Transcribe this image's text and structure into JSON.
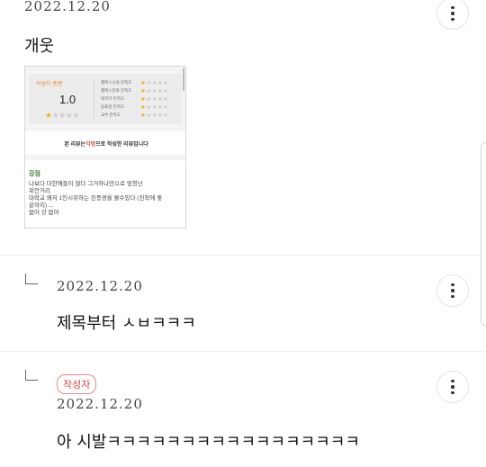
{
  "comments": [
    {
      "date": "2022.12.20",
      "text": "개웃",
      "more_icon": "more-vertical-icon",
      "attachment": {
        "summary_label": "작성자 총평",
        "overall_score": "1.0",
        "overall_stars": 1,
        "ratings": [
          {
            "label": "캠퍼스시설 만족도",
            "stars": 1
          },
          {
            "label": "캠퍼스문화 만족도",
            "stars": 1
          },
          {
            "label": "대학가 만족도",
            "stars": 1
          },
          {
            "label": "동료감 만족도",
            "stars": 1
          },
          {
            "label": "교수 만족도",
            "stars": 1
          }
        ],
        "notice_pre": "본 리뷰는 ",
        "notice_highlight": "익명",
        "notice_post": "으로 작성한 리뷰입니다",
        "review_title": "강점",
        "review_lines": [
          "나보다 더한애들이 많다 그거하나만으로 엄청난",
          "위안거리",
          "대학교 왜저 1인시위하는 진풍경을 볼수있다 (진착에 좋",
          "같하지) ...",
          "없어 강 없어"
        ]
      }
    },
    {
      "reply_icon": "reply-arrow-icon",
      "date": "2022.12.20",
      "text": "제목부터 ㅅㅂㅋㅋㅋ",
      "more_icon": "more-vertical-icon"
    },
    {
      "reply_icon": "reply-arrow-icon",
      "badge": "작성자",
      "date": "2022.12.20",
      "text": "아 시발ㅋㅋㅋㅋㅋㅋㅋㅋㅋㅋㅋㅋㅋㅋㅋㅋㅋ",
      "more_icon": "more-vertical-icon"
    }
  ]
}
